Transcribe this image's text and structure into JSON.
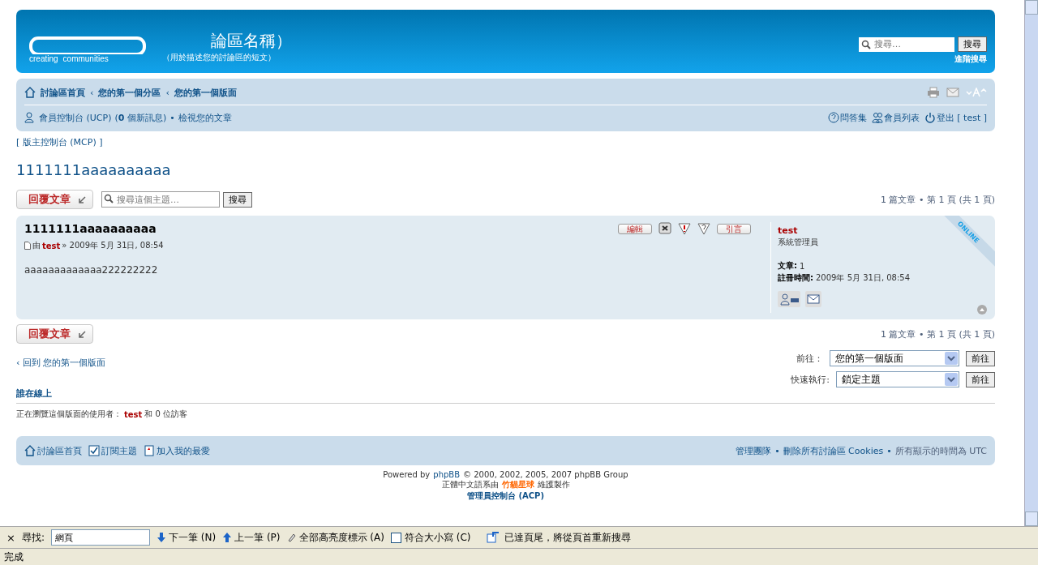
{
  "header": {
    "logo_tagline": [
      "creating",
      "communities"
    ],
    "site_title": "論區名稱）",
    "site_description": "（用於描述您的討論區的短文）",
    "search": {
      "placeholder": "搜尋…",
      "button": "搜尋",
      "advanced": "進階搜尋"
    }
  },
  "navbar": {
    "breadcrumbs": [
      "討論區首頁",
      "您的第一個分區",
      "您的第一個版面"
    ],
    "breadcrumb_separator": "‹",
    "ucp": {
      "label": "會員控制台 (UCP)",
      "pm_prefix": "(",
      "pm_count": "0",
      "pm_suffix": "個新訊息)",
      "separator": "•",
      "own_posts": "檢視您的文章"
    },
    "links": [
      {
        "kind": "faq",
        "label": "問答集"
      },
      {
        "kind": "members",
        "label": "會員列表"
      },
      {
        "kind": "logout",
        "label": "登出 [ test ]"
      }
    ]
  },
  "mcp_link": "[ 版主控制台 (MCP) ]",
  "topic_title": "1111111aaaaaaaaaa",
  "reply_button": "回覆文章",
  "topic_search": {
    "placeholder": "搜尋這個主題…",
    "button": "搜尋"
  },
  "pagination": "1 篇文章 • 第 1 頁 (共 1 頁)",
  "reply_button_bottom": "回覆文章",
  "pagination_bottom": "1 篇文章 • 第 1 頁 (共 1 頁)",
  "post": {
    "subject": "1111111aaaaaaaaaa",
    "by": "由",
    "author": "test",
    "date": "» 2009年 5月 31日, 08:54",
    "content": "aaaaaaaaaaaaa222222222",
    "buttons": [
      {
        "kind": "edit",
        "label": "編輯"
      },
      {
        "kind": "delete"
      },
      {
        "kind": "report"
      },
      {
        "kind": "info"
      },
      {
        "kind": "quote",
        "label": "引言"
      }
    ],
    "online": true,
    "online_label": "ONLINE",
    "profile": {
      "name": "test",
      "rank": "系統管理員",
      "posts_label": "文章:",
      "posts": "1",
      "joined_label": "註冊時間:",
      "joined": "2009年 5月 31日, 08:54"
    }
  },
  "back_link": "‹ 回到 您的第一個版面",
  "jump": {
    "label": "前往：",
    "value": "您的第一個版面",
    "button": "前往"
  },
  "quick_mod": {
    "label": "快速執行:",
    "value": "鎖定主題",
    "button": "前往"
  },
  "who_online": {
    "title": "誰在線上",
    "prefix": "正在瀏覽這個版面的使用者：",
    "user": "test",
    "suffix": "和 0 位訪客"
  },
  "footer": {
    "left": [
      {
        "kind": "home",
        "label": "討論區首頁"
      },
      {
        "kind": "subscribe",
        "label": "訂閱主題"
      },
      {
        "kind": "bookmark",
        "label": "加入我的最愛"
      }
    ],
    "team": "管理團隊",
    "separator": "•",
    "delete_cookies": "刪除所有討論區 Cookies",
    "timezone": "所有顯示的時間為 UTC"
  },
  "copyright": {
    "line1_a": "Powered by",
    "line1_link": "phpBB",
    "line1_b": "© 2000, 2002, 2005, 2007 phpBB Group",
    "line2_a": "正體中文語系由",
    "line2_link": "竹貓星球",
    "line2_b": "維護製作",
    "acp": "管理員控制台 (ACP)"
  },
  "find_bar": {
    "close": "×",
    "label": "尋找:",
    "value": "網頁",
    "next": "下一筆 (N)",
    "prev": "上一筆 (P)",
    "highlight": "全部高亮度標示 (A)",
    "match_case": "符合大小寫 (C)",
    "match_case_checked": false,
    "message": "已達頁尾，將從頁首重新搜尋"
  },
  "status_bar": "完成"
}
